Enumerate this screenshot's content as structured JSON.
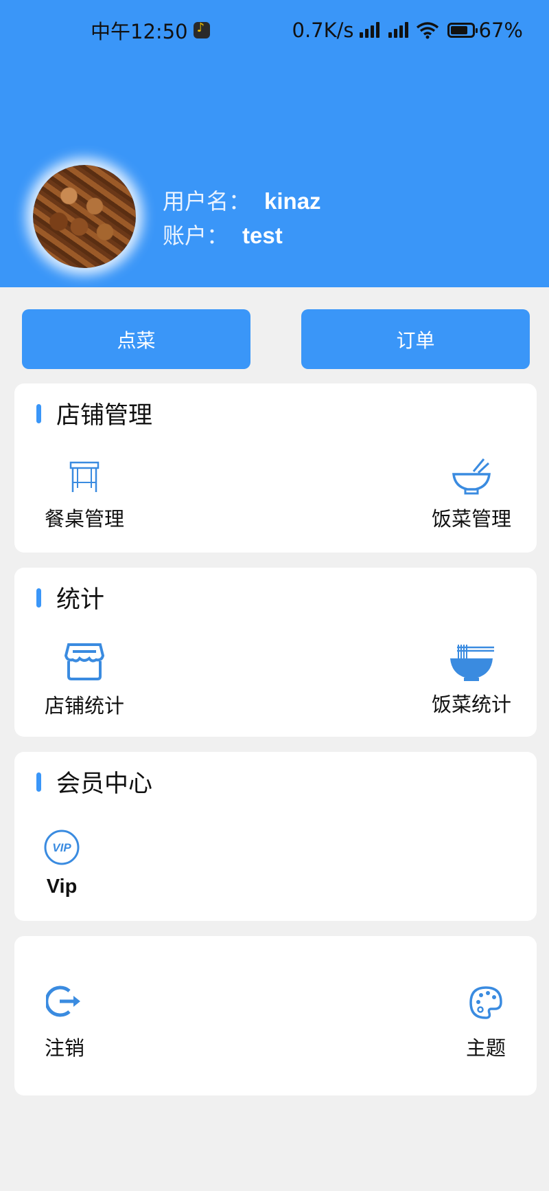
{
  "status_bar": {
    "time": "中午12:50",
    "network_speed": "0.7K/s",
    "battery": "67%"
  },
  "profile": {
    "username_label": "用户名：",
    "username": "kinaz",
    "account_label": "账户：",
    "account": "test"
  },
  "actions": {
    "order_food": "点菜",
    "orders": "订单"
  },
  "store_management": {
    "title": "店铺管理",
    "items": [
      {
        "label": "餐桌管理",
        "icon": "table-icon"
      },
      {
        "label": "饭菜管理",
        "icon": "bowl-icon"
      }
    ]
  },
  "statistics": {
    "title": "统计",
    "items": [
      {
        "label": "店铺统计",
        "icon": "store-icon"
      },
      {
        "label": "饭菜统计",
        "icon": "noodle-bowl-icon"
      }
    ]
  },
  "member_center": {
    "title": "会员中心",
    "items": [
      {
        "label": "Vip",
        "icon": "vip-icon"
      }
    ]
  },
  "settings": {
    "items": [
      {
        "label": "注销",
        "icon": "logout-icon"
      },
      {
        "label": "主题",
        "icon": "palette-icon"
      }
    ]
  },
  "colors": {
    "primary": "#3a96f8",
    "background": "#f0f0f0",
    "card": "#ffffff"
  }
}
